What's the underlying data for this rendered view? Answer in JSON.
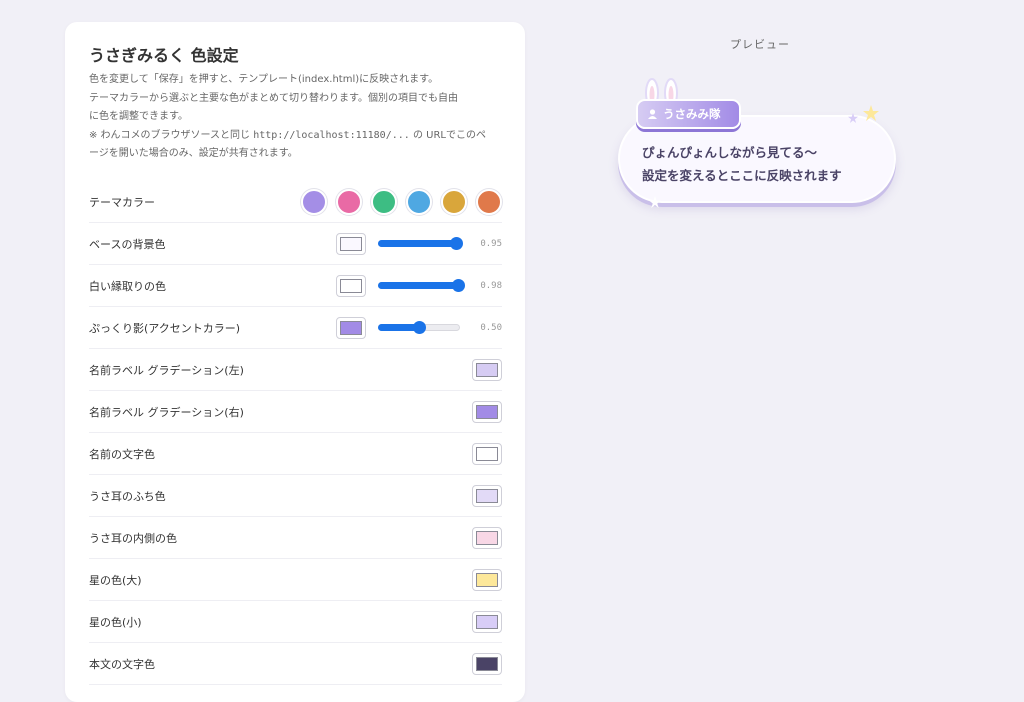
{
  "settings": {
    "title": "うさぎみるく 色設定",
    "description": [
      "色を変更して「保存」を押すと、テンプレート(index.html)に反映されます。",
      "テーマカラーから選ぶと主要な色がまとめて切り替わります。個別の項目でも自由",
      "に色を調整できます。"
    ],
    "note_prefix": "※ わんコメのブラウザソースと同じ",
    "note_url": "http://localhost:11180/...",
    "note_suffix": "の URLでこのペ",
    "note_line2": "ージを開いた場合のみ、設定が共有されます。",
    "theme_label": "テーマカラー",
    "theme_colors": [
      "#a48ee6",
      "#e96aa5",
      "#3dbd83",
      "#4fa8e2",
      "#d9a63b",
      "#e0794a"
    ],
    "rows": [
      {
        "label": "ベースの背景色",
        "color": "#faf8ff",
        "slider": 0.95,
        "value": "0.95"
      },
      {
        "label": "白い縁取りの色",
        "color": "#ffffff",
        "slider": 0.98,
        "value": "0.98"
      },
      {
        "label": "ぷっくり影(アクセントカラー)",
        "color": "#a28be6",
        "slider": 0.5,
        "value": "0.50"
      },
      {
        "label": "名前ラベル グラデーション(左)",
        "color": "#d6ccf3"
      },
      {
        "label": "名前ラベル グラデーション(右)",
        "color": "#a28be6"
      },
      {
        "label": "名前の文字色",
        "color": "#ffffff"
      },
      {
        "label": "うさ耳のふち色",
        "color": "#e2daf7"
      },
      {
        "label": "うさ耳の内側の色",
        "color": "#f8d7e6"
      },
      {
        "label": "星の色(大)",
        "color": "#fde89a"
      },
      {
        "label": "星の色(小)",
        "color": "#d8cdf7"
      },
      {
        "label": "本文の文字色",
        "color": "#4a4366"
      }
    ]
  },
  "preview": {
    "title": "プレビュー",
    "name": "うさみみ隊",
    "lines": [
      "ぴょんぴょんしながら見てる〜",
      "設定を変えるとここに反映されます"
    ],
    "colors": {
      "star_large": "#fde89a",
      "star_small": "#d8cdf7",
      "ear_edge": "#e2daf7",
      "ear_inner": "#f8d7e6"
    }
  }
}
